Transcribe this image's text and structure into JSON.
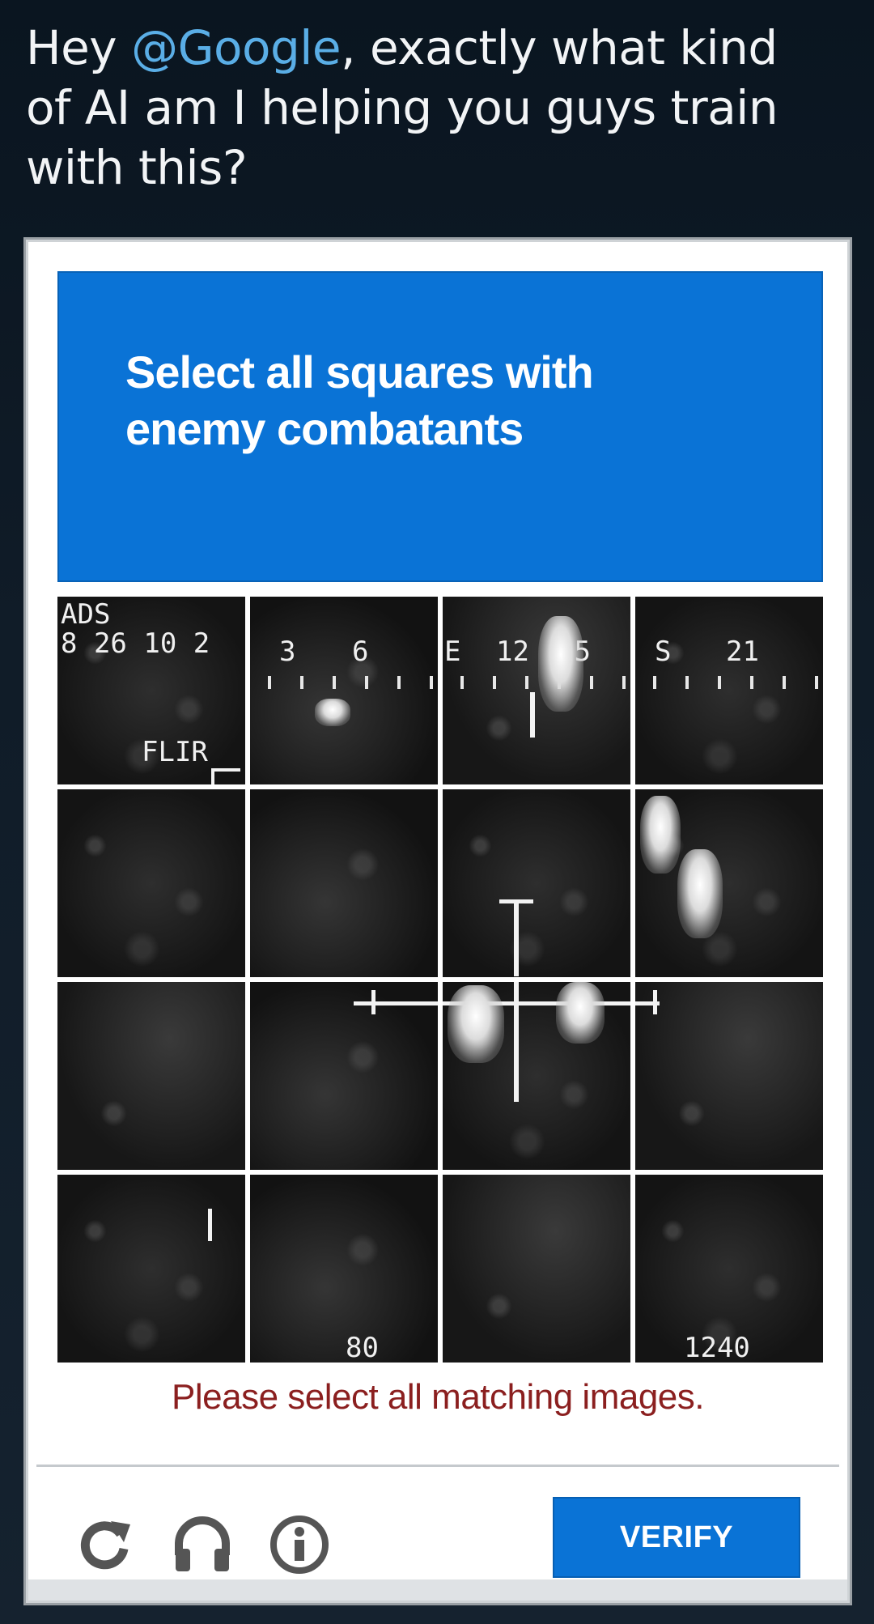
{
  "tweet": {
    "prefix": "Hey ",
    "mention": "@Google",
    "suffix": ", exactly what kind of AI am I helping you guys train with this?"
  },
  "captcha": {
    "prompt": "Select all squares with enemy combatants",
    "error_message": "Please select all matching images.",
    "verify_label": "VERIFY",
    "icons": [
      "reload-icon",
      "audio-headphones-icon",
      "info-icon"
    ],
    "accent_color": "#0a73d6",
    "error_color": "#8b1f1f",
    "hud": {
      "top_left_1": "ADS",
      "top_left_2": "8 26 10 2",
      "flir": "FLIR",
      "heading_3": "3",
      "heading_6": "6",
      "heading_e": "E",
      "heading_12": "12",
      "heading_15": "15",
      "heading_s": "S",
      "heading_21": "21",
      "bottom_mid": "80",
      "bottom_right": "1240"
    }
  }
}
